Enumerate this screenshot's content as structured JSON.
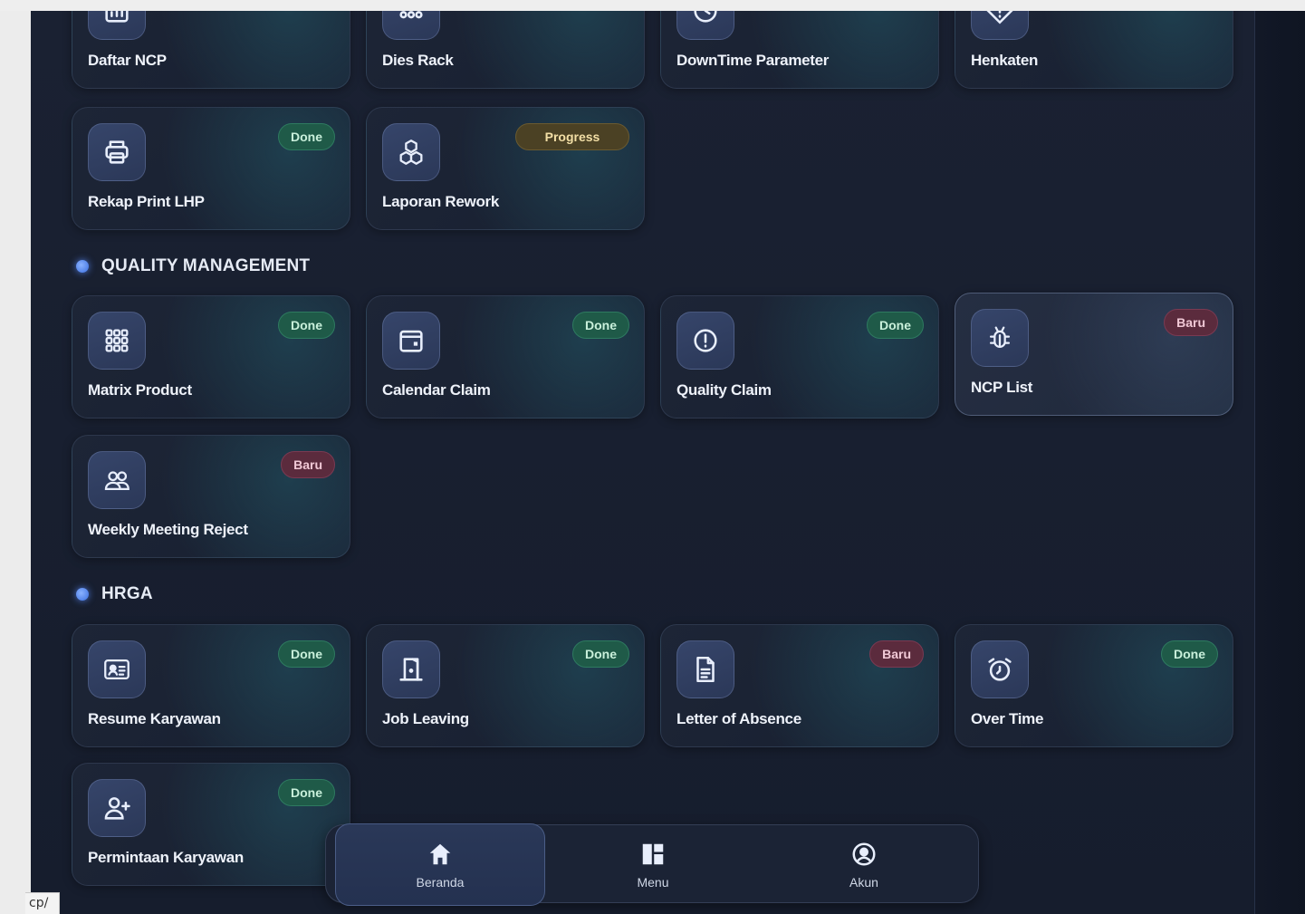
{
  "colors": {
    "background": "#161d2d",
    "card": "#1d2536",
    "icon_box": "#32406a",
    "badge_done": "#1f5a48",
    "badge_baru": "#5b2b3d",
    "badge_progress": "#4b4124",
    "accent_dot": "#5b8cff"
  },
  "top_row": [
    {
      "label": "Daftar NCP",
      "icon": "bar-chart-icon"
    },
    {
      "label": "Dies Rack",
      "icon": "rack-icon"
    },
    {
      "label": "DownTime Parameter",
      "icon": "clock-icon"
    },
    {
      "label": "Henkaten",
      "icon": "diamond-alert-icon"
    }
  ],
  "production_row2": [
    {
      "label": "Rekap Print LHP",
      "icon": "printer-icon",
      "badge": "Done"
    },
    {
      "label": "Laporan Rework",
      "icon": "boxes-icon",
      "badge": "Progress"
    }
  ],
  "quality": {
    "title": "QUALITY MANAGEMENT",
    "items": [
      {
        "label": "Matrix Product",
        "icon": "grid-icon",
        "badge": "Done"
      },
      {
        "label": "Calendar Claim",
        "icon": "calendar-icon",
        "badge": "Done"
      },
      {
        "label": "Quality Claim",
        "icon": "alert-circle-icon",
        "badge": "Done"
      },
      {
        "label": "NCP List",
        "icon": "bug-icon",
        "badge": "Baru"
      },
      {
        "label": "Weekly Meeting Reject",
        "icon": "users-icon",
        "badge": "Baru"
      }
    ]
  },
  "hrga": {
    "title": "HRGA",
    "items": [
      {
        "label": "Resume Karyawan",
        "icon": "id-card-icon",
        "badge": "Done"
      },
      {
        "label": "Job Leaving",
        "icon": "door-icon",
        "badge": "Done"
      },
      {
        "label": "Letter of Absence",
        "icon": "document-icon",
        "badge": "Baru"
      },
      {
        "label": "Over Time",
        "icon": "alarm-clock-icon",
        "badge": "Done"
      },
      {
        "label": "Permintaan Karyawan",
        "icon": "user-plus-icon",
        "badge": "Done"
      }
    ]
  },
  "bottom_nav": [
    {
      "label": "Beranda",
      "icon": "home-icon",
      "active": true
    },
    {
      "label": "Menu",
      "icon": "layout-icon",
      "active": false
    },
    {
      "label": "Akun",
      "icon": "user-circle-icon",
      "active": false
    }
  ],
  "status_url": "cp/"
}
